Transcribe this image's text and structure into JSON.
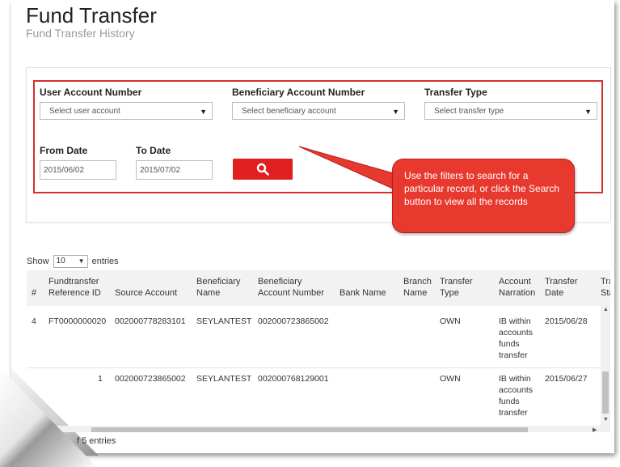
{
  "header": {
    "title": "Fund Transfer",
    "subtitle": "Fund Transfer History"
  },
  "filters": {
    "user_account_label": "User Account Number",
    "user_account_placeholder": "Select user account",
    "beneficiary_label": "Beneficiary Account Number",
    "beneficiary_placeholder": "Select beneficiary account",
    "transfer_type_label": "Transfer Type",
    "transfer_type_placeholder": "Select transfer type",
    "from_date_label": "From Date",
    "from_date_value": "2015/06/02",
    "to_date_label": "To Date",
    "to_date_value": "2015/07/02",
    "search_icon": "search-icon"
  },
  "callout": {
    "text": "Use the filters to search for a particular record, or click the Search button to view all the records"
  },
  "table_controls": {
    "show_prefix": "Show",
    "page_length": "10",
    "show_suffix": "entries"
  },
  "table": {
    "columns": [
      "#",
      "Fundtransfer Reference ID",
      "Source Account",
      "Beneficiary Name",
      "Beneficiary Account Number",
      "Bank Name",
      "Branch Name",
      "Transfer Type",
      "Account Narration",
      "Transfer Date",
      "Tra Sta"
    ],
    "rows": [
      {
        "num": "4",
        "ref": "FT0000000020",
        "source": "002000778283101",
        "ben_name": "SEYLANTEST",
        "ben_account": "002000723865002",
        "bank": "",
        "branch": "",
        "type": "OWN",
        "narration": "IB within accounts funds transfer",
        "date": "2015/06/28"
      },
      {
        "num": "",
        "ref": "1",
        "source": "002000723865002",
        "ben_name": "SEYLANTEST",
        "ben_account": "002000768129001",
        "bank": "",
        "branch": "",
        "type": "OWN",
        "narration": "IB within accounts funds transfer",
        "date": "2015/06/27"
      }
    ]
  },
  "footer": {
    "info": "f 5 entries"
  },
  "colors": {
    "accent": "#e02020",
    "callout": "#e8392f",
    "highlight_border": "#d32f2f"
  }
}
